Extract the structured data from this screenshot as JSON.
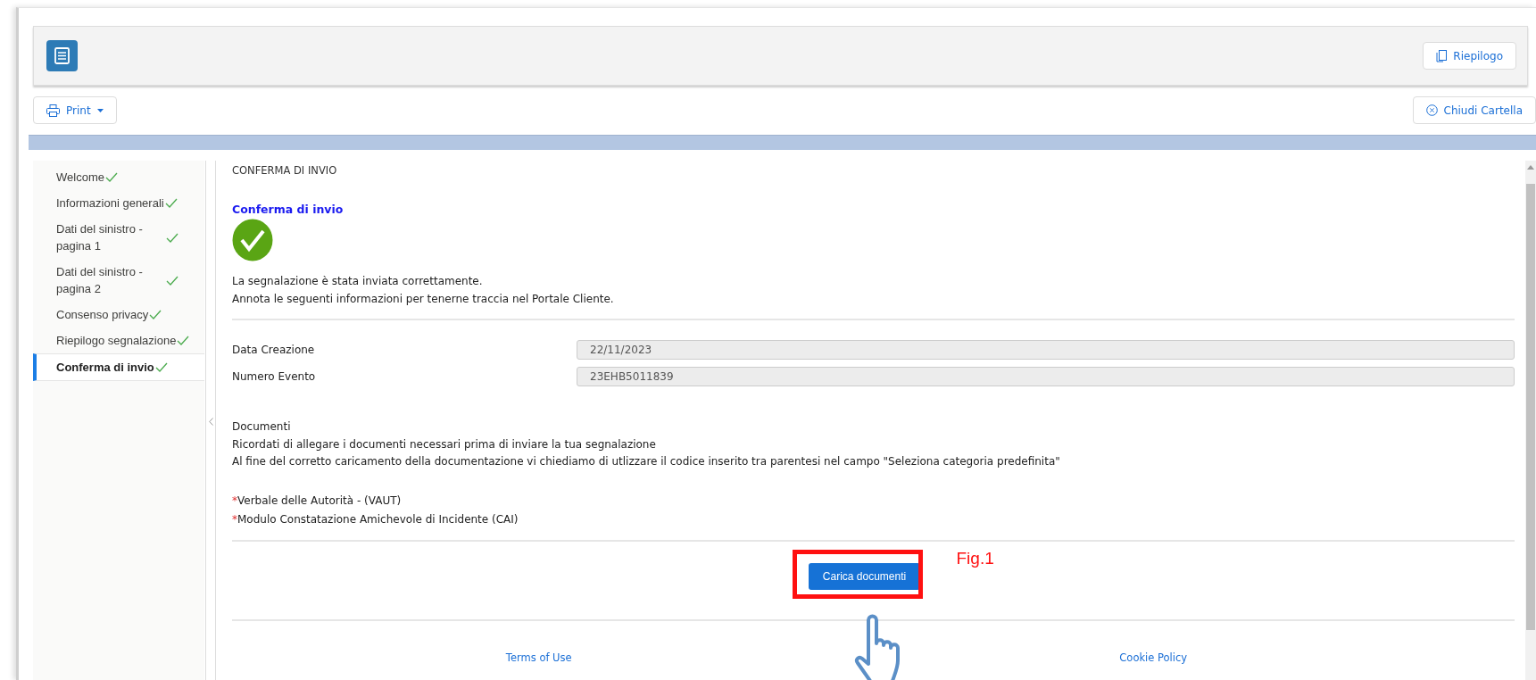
{
  "header": {
    "summary_button": "Riepilogo"
  },
  "toolbar": {
    "print_button": "Print",
    "close_button": "Chiudi Cartella"
  },
  "steps": [
    {
      "label": "Welcome",
      "done": true,
      "selected": false
    },
    {
      "label": "Informazioni generali",
      "done": true,
      "selected": false
    },
    {
      "label": "Dati del sinistro - pagina 1",
      "done": true,
      "selected": false
    },
    {
      "label": "Dati del sinistro - pagina 2",
      "done": true,
      "selected": false
    },
    {
      "label": "Consenso privacy",
      "done": true,
      "selected": false
    },
    {
      "label": "Riepilogo segnalazione",
      "done": true,
      "selected": false
    },
    {
      "label": "Conferma di invio",
      "done": true,
      "selected": true
    }
  ],
  "content": {
    "section_title": "CONFERMA DI INVIO",
    "heading": "Conferma di invio",
    "message": [
      "La segnalazione è stata inviata correttamente.",
      "Annota le seguenti informazioni per tenerne traccia nel Portale Cliente."
    ],
    "fields": [
      {
        "label": "Data Creazione",
        "value": "22/11/2023",
        "disabled": true
      },
      {
        "label": "Numero Evento",
        "value": "23EHB5011839",
        "disabled": true
      }
    ],
    "documents": {
      "title": "Documenti",
      "notes": [
        "Ricordati di allegare i documenti necessari prima di inviare la tua segnalazione",
        "Al fine del corretto caricamento della documentazione vi chiediamo di utlizzare il codice inserito tra parentesi nel campo \"Seleziona categoria predefinita\""
      ],
      "required": [
        {
          "marker": "*",
          "label": "Verbale delle Autorità - (VAUT)"
        },
        {
          "marker": "*",
          "label": "Modulo Constatazione Amichevole di Incidente (CAI)"
        }
      ]
    },
    "upload_button": "Carica documenti"
  },
  "footer": {
    "links": [
      "Terms of Use",
      "Cookie Policy"
    ]
  },
  "annotation": {
    "label": "Fig.1"
  }
}
